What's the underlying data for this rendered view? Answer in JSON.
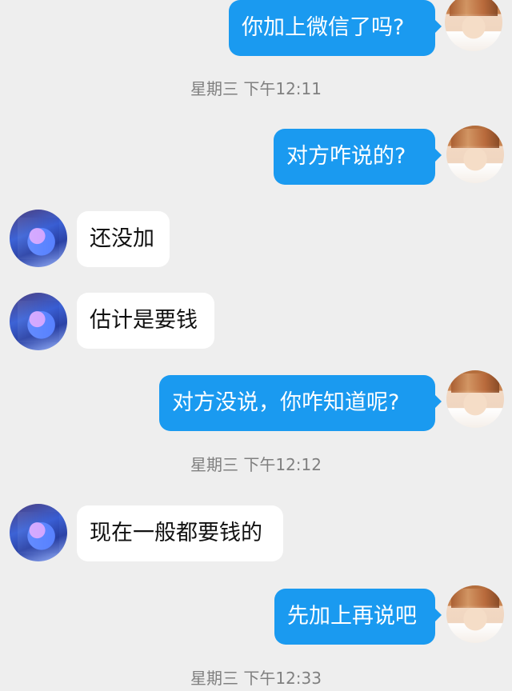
{
  "messages": [
    {
      "text": "你加上微信了吗?",
      "side": "out"
    },
    {
      "text": "对方咋说的?",
      "side": "out"
    },
    {
      "text": "还没加",
      "side": "in"
    },
    {
      "text": "估计是要钱",
      "side": "in"
    },
    {
      "text": "对方没说，你咋知道呢?",
      "side": "out"
    },
    {
      "text": "现在一般都要钱的",
      "side": "in"
    },
    {
      "text": "先加上再说吧",
      "side": "out"
    }
  ],
  "timestamps": [
    "星期三 下午12:11",
    "星期三 下午12:12",
    "星期三 下午12:33"
  ],
  "avatars": {
    "me": "avatar-me",
    "other": "avatar-other"
  },
  "colors": {
    "outgoing_bubble": "#1a9af0",
    "incoming_bubble": "#ffffff",
    "background": "#eeeeee",
    "timestamp_text": "#808080"
  }
}
